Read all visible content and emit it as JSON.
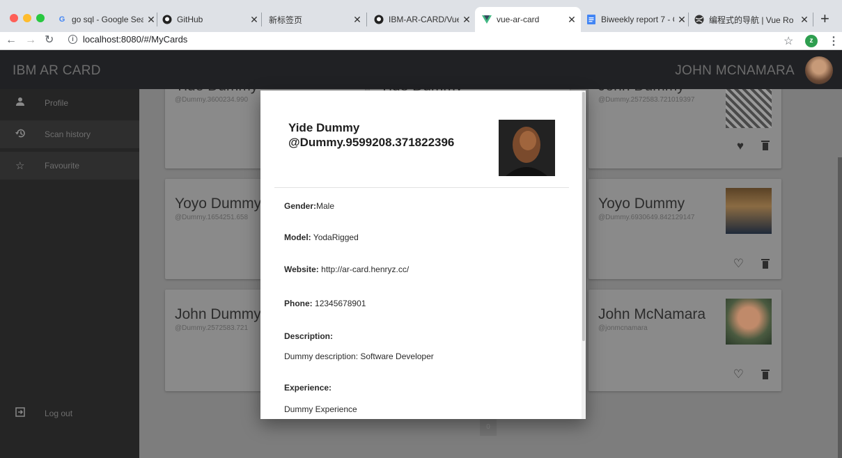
{
  "browser": {
    "tabs": [
      {
        "title": "go sql - Google Searc",
        "icon": "google-icon"
      },
      {
        "title": "GitHub",
        "icon": "github-icon"
      },
      {
        "title": "新标签页",
        "icon": "none"
      },
      {
        "title": "IBM-AR-CARD/Vue-A",
        "icon": "github-icon"
      },
      {
        "title": "vue-ar-card",
        "icon": "vue-icon"
      },
      {
        "title": "Biweekly report 7 - Go",
        "icon": "docs-icon"
      },
      {
        "title": "编程式的导航 | Vue Ro",
        "icon": "globe-icon"
      }
    ],
    "address": {
      "host": "localhost",
      "path": ":8080/#/MyCards"
    },
    "profile_initial": "z",
    "colors": {
      "tab_strip": "#dee1e6",
      "profile": "#2e9e4f"
    }
  },
  "app": {
    "title": "IBM AR CARD",
    "user_name": "JOHN MCNAMARA",
    "sidebar": {
      "items": [
        {
          "label": "Profile",
          "icon": "person-icon"
        },
        {
          "label": "Scan history",
          "icon": "history-icon"
        },
        {
          "label": "Favourite",
          "icon": "star-outline-icon"
        }
      ],
      "logout": {
        "label": "Log out",
        "icon": "logout-icon"
      }
    },
    "cards": [
      {
        "name": "Yide Dummy",
        "handle": "@Dummy.3600234.990"
      },
      {
        "name": "Yide Dummy",
        "handle": ""
      },
      {
        "name": "John Dummy",
        "handle": "@Dummy.2572583.721019397",
        "favourite": true
      },
      {
        "name": "Yoyo Dummy",
        "handle": "@Dummy.1654251.658"
      },
      {
        "name": "Yoyo Dummy",
        "handle": "@Dummy.6930649.842129147",
        "favourite": false
      },
      {
        "name": "John Dummy",
        "handle": "@Dummy.2572583.721"
      },
      {
        "name": "John McNamara",
        "handle": "@jonmcnamara",
        "favourite": false
      }
    ],
    "pager": {
      "current": "0"
    }
  },
  "modal": {
    "name": "Yide Dummy",
    "handle": "@Dummy.9599208.371822396",
    "gender_label": "Gender:",
    "gender": "Male",
    "model_label": "Model:",
    "model": "YodaRigged",
    "website_label": "Website:",
    "website": "http://ar-card.henryz.cc/",
    "phone_label": "Phone:",
    "phone": "12345678901",
    "description_label": "Description:",
    "description": "Dummy description: Software Developer",
    "experience_label": "Experience:",
    "experience": "Dummy Experience"
  }
}
